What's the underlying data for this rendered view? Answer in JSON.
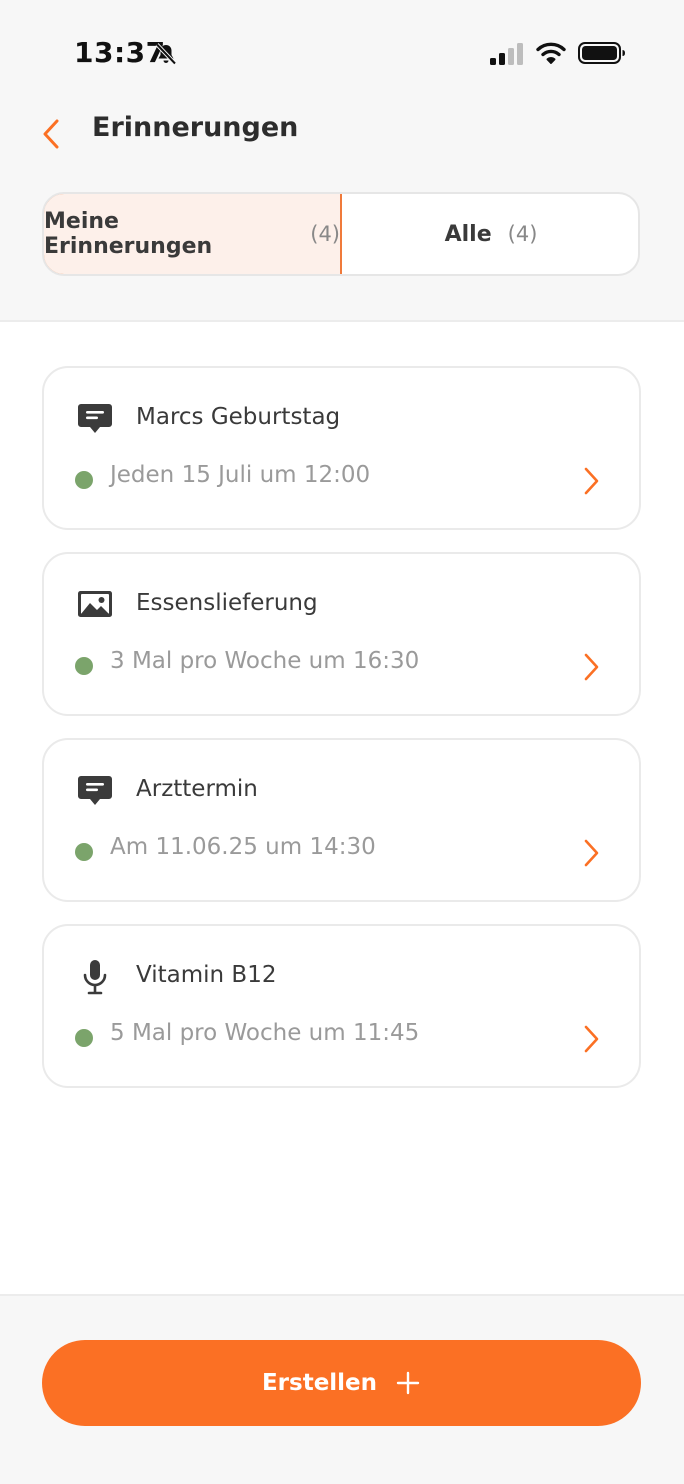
{
  "status_bar": {
    "time": "13:37",
    "icons": [
      "bell-slash-icon",
      "cellular-signal-icon",
      "wifi-icon",
      "battery-icon"
    ]
  },
  "header": {
    "title": "Erinnerungen",
    "back_icon": "chevron-left-icon"
  },
  "segmented_control": {
    "tabs": [
      {
        "label": "Meine Erinnerungen",
        "count": "(4)",
        "active": true
      },
      {
        "label": "Alle",
        "count": "(4)",
        "active": false
      }
    ]
  },
  "reminders": [
    {
      "title": "Marcs Geburtstag",
      "schedule": "Jeden 15 Juli um 12:00",
      "icon": "message-icon",
      "status": "active"
    },
    {
      "title": "Essenslieferung",
      "schedule": "3 Mal pro Woche um 16:30",
      "icon": "image-icon",
      "status": "active"
    },
    {
      "title": "Arzttermin",
      "schedule": "Am 11.06.25 um 14:30",
      "icon": "message-icon",
      "status": "active"
    },
    {
      "title": "Vitamin B12",
      "schedule": "5 Mal pro Woche um 11:45",
      "icon": "microphone-icon",
      "status": "active"
    }
  ],
  "footer": {
    "create_label": "Erstellen",
    "create_icon": "plus-icon"
  },
  "colors": {
    "accent": "#fb7024",
    "active_tab_bg": "#fdf0ea",
    "status_active": "#7ba46b"
  }
}
